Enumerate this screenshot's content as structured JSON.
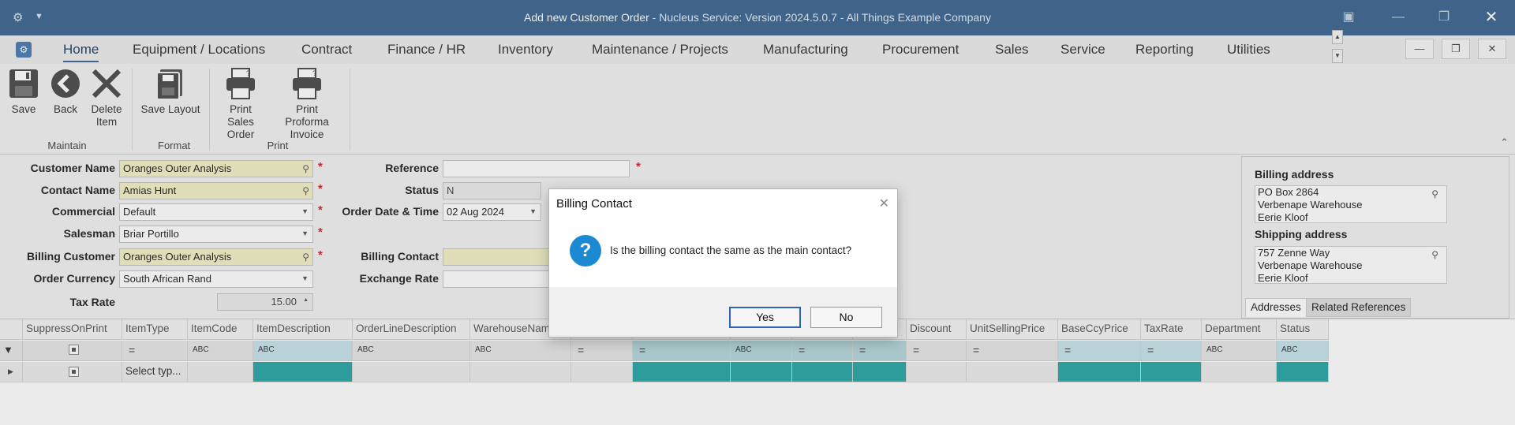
{
  "window": {
    "title_main": "Add new Customer Order",
    "title_suffix": " - Nucleus Service: Version 2024.5.0.7 - All Things Example Company"
  },
  "menu": {
    "tabs": [
      "Home",
      "Equipment / Locations",
      "Contract",
      "Finance / HR",
      "Inventory",
      "Maintenance / Projects",
      "Manufacturing",
      "Procurement",
      "Sales",
      "Service",
      "Reporting",
      "Utilities"
    ],
    "active": "Home"
  },
  "ribbon": {
    "buttons": {
      "save": "Save",
      "back": "Back",
      "delete": "Delete Item",
      "save_layout": "Save Layout",
      "print_sales": "Print Sales Order",
      "print_proforma": "Print Proforma Invoice"
    },
    "groups": {
      "maintain": "Maintain",
      "format": "Format",
      "print": "Print"
    }
  },
  "form": {
    "customer_name": {
      "label": "Customer Name",
      "value": "Oranges Outer Analysis"
    },
    "contact_name": {
      "label": "Contact Name",
      "value": "Amias Hunt"
    },
    "commercial": {
      "label": "Commercial",
      "value": "Default"
    },
    "salesman": {
      "label": "Salesman",
      "value": "Briar Portillo"
    },
    "billing_customer": {
      "label": "Billing Customer",
      "value": "Oranges Outer Analysis"
    },
    "order_currency": {
      "label": "Order Currency",
      "value": "South African Rand"
    },
    "tax_rate": {
      "label": "Tax Rate",
      "value": "15.00"
    },
    "reference": {
      "label": "Reference",
      "value": ""
    },
    "status": {
      "label": "Status",
      "value": "N"
    },
    "order_date": {
      "label": "Order Date & Time",
      "value": "02 Aug 2024"
    },
    "billing_contact": {
      "label": "Billing Contact",
      "value": ""
    },
    "exchange_rate": {
      "label": "Exchange Rate",
      "value": ""
    }
  },
  "addresses": {
    "billing_title": "Billing address",
    "billing_lines": [
      "PO Box 2864",
      "Verbenape Warehouse",
      "Eerie Kloof"
    ],
    "shipping_title": "Shipping address",
    "shipping_lines": [
      "757 Zenne Way",
      "Verbenape Warehouse",
      "Eerie Kloof"
    ],
    "tab_addresses": "Addresses",
    "tab_related": "Related References"
  },
  "grid": {
    "columns": [
      "SuppressOnPrint",
      "ItemType",
      "ItemCode",
      "ItemDescription",
      "OrderLineDescription",
      "WarehouseName",
      "",
      "",
      "",
      "",
      "",
      "Discount",
      "UnitSellingPrice",
      "BaseCcyPrice",
      "TaxRate",
      "Department",
      "Status"
    ],
    "new_row_itemtype": "Select typ..."
  },
  "dialog": {
    "title": "Billing Contact",
    "message": "Is the billing contact the same as the main contact?",
    "yes": "Yes",
    "no": "No",
    "accent": "#1c8ad2"
  },
  "colors": {
    "titlebar": "#3d6690",
    "required_field": "#f3f1c7",
    "teal": "#2aa5a5"
  }
}
